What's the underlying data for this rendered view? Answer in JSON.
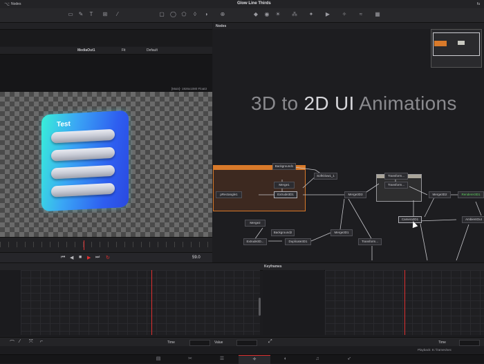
{
  "window": {
    "title": "Glow Line Thirds",
    "right_label": "fu"
  },
  "topbar": {
    "nodes_label": "Nodes"
  },
  "viewer": {
    "label": "MediaOut1",
    "layout_label": "Default",
    "zoom": "Fit",
    "resolution": "[Main]- 1926x1080 Float3",
    "card_title": "Test",
    "frame": "59.0"
  },
  "nodes_panel": {
    "label": "Nodes",
    "headline_prefix": "3D to ",
    "headline_big": "2D UI",
    "headline_suffix": " Animations",
    "nodes": [
      {
        "id": "background1",
        "label": "Background1"
      },
      {
        "id": "softglow1",
        "label": "SoftGlow1_1"
      },
      {
        "id": "merge1",
        "label": "Merge1"
      },
      {
        "id": "prectangle1",
        "label": "pRectangle1"
      },
      {
        "id": "extrude3d1",
        "label": "Extrude3D1"
      },
      {
        "id": "merge3d3",
        "label": "Merge3D3"
      },
      {
        "id": "transform_a",
        "label": "Transform..."
      },
      {
        "id": "transform_b",
        "label": "Transform..."
      },
      {
        "id": "merge3d2",
        "label": "Merge3D2"
      },
      {
        "id": "renderer3d1",
        "label": "Renderer3D1"
      },
      {
        "id": "merge2",
        "label": "Merge2"
      },
      {
        "id": "camera3d1",
        "label": "Camera3D1"
      },
      {
        "id": "ambientout",
        "label": "AmbientOut"
      },
      {
        "id": "background2",
        "label": "Background2"
      },
      {
        "id": "merge3d1",
        "label": "Merge3D1"
      },
      {
        "id": "extrude3d_b",
        "label": "Extrude3D..."
      },
      {
        "id": "duplicate3d1",
        "label": "Duplicate3D1"
      },
      {
        "id": "transform_c",
        "label": "Transform..."
      }
    ]
  },
  "keyframes": {
    "label": "Keyframes",
    "playhead_label": "Playback: 8 / frames/sec"
  },
  "bottom": {
    "time_label": "Time",
    "value_label": "Value",
    "time_label_right": "Time"
  },
  "colors": {
    "accent_orange": "#d97a2a",
    "playhead_red": "#e03030",
    "card_cyan": "#39f0d8",
    "card_blue": "#2e5ef0",
    "render_green": "#5fd35f"
  },
  "page_icons": [
    "media-icon",
    "cut-icon",
    "edit-icon",
    "fusion-icon",
    "color-icon",
    "fairlight-icon",
    "deliver-icon"
  ]
}
